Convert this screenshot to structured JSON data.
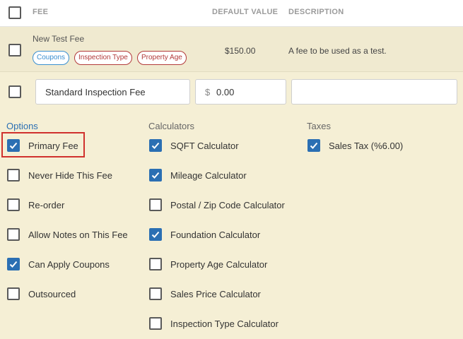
{
  "header": {
    "fee": "FEE",
    "default_value": "DEFAULT VALUE",
    "description": "DESCRIPTION"
  },
  "existing_fee": {
    "name": "New Test Fee",
    "tags": [
      "Coupons",
      "Inspection Type",
      "Property Age"
    ],
    "value": "$150.00",
    "description": "A fee to be used as a test."
  },
  "edit_row": {
    "name_value": "Standard Inspection Fee",
    "currency_symbol": "$",
    "amount_value": "0.00",
    "description_value": ""
  },
  "sections": {
    "options": "Options",
    "calculators": "Calculators",
    "taxes": "Taxes"
  },
  "options": [
    {
      "label": "Primary Fee",
      "checked": true
    },
    {
      "label": "Never Hide This Fee",
      "checked": false
    },
    {
      "label": "Re-order",
      "checked": false
    },
    {
      "label": "Allow Notes on This Fee",
      "checked": false
    },
    {
      "label": "Can Apply Coupons",
      "checked": true
    },
    {
      "label": "Outsourced",
      "checked": false
    }
  ],
  "calculators": [
    {
      "label": "SQFT Calculator",
      "checked": true
    },
    {
      "label": "Mileage Calculator",
      "checked": true
    },
    {
      "label": "Postal / Zip Code Calculator",
      "checked": false
    },
    {
      "label": "Foundation Calculator",
      "checked": true
    },
    {
      "label": "Property Age Calculator",
      "checked": false
    },
    {
      "label": "Sales Price Calculator",
      "checked": false
    },
    {
      "label": "Inspection Type Calculator",
      "checked": false
    }
  ],
  "taxes": [
    {
      "label": "Sales Tax (%6.00)",
      "checked": true
    }
  ],
  "colors": {
    "accent": "#2b6fb3",
    "highlight": "#d0312d",
    "panel_bg": "#f5efd5"
  }
}
